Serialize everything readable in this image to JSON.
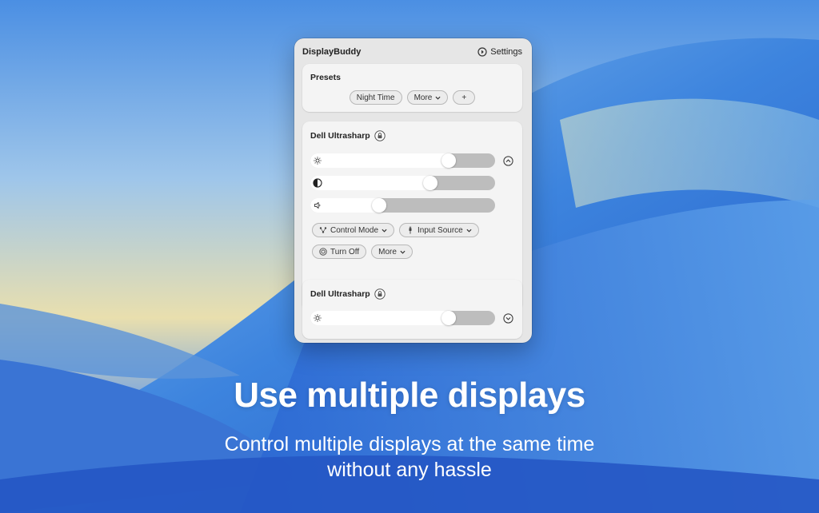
{
  "panel": {
    "app_title": "DisplayBuddy",
    "settings_label": "Settings"
  },
  "presets": {
    "title": "Presets",
    "items": [
      "Night Time",
      "More",
      "+"
    ]
  },
  "displays": [
    {
      "name": "Dell Ultrasharp",
      "brightness": 0.77,
      "contrast": 0.66,
      "volume": 0.36,
      "buttons": {
        "control_mode": "Control Mode",
        "input_source": "Input Source",
        "turn_off": "Turn Off",
        "more": "More"
      },
      "expanded": true
    },
    {
      "name": "Dell Ultrasharp",
      "brightness": 0.77,
      "expanded": false
    }
  ],
  "marketing": {
    "headline": "Use multiple displays",
    "subline_1": "Control multiple displays at the same time",
    "subline_2": "without any hassle"
  },
  "colors": {
    "slider_fill": "#ffffff",
    "slider_track": "#bdbdbd",
    "panel_bg": "#e6e6e6"
  }
}
